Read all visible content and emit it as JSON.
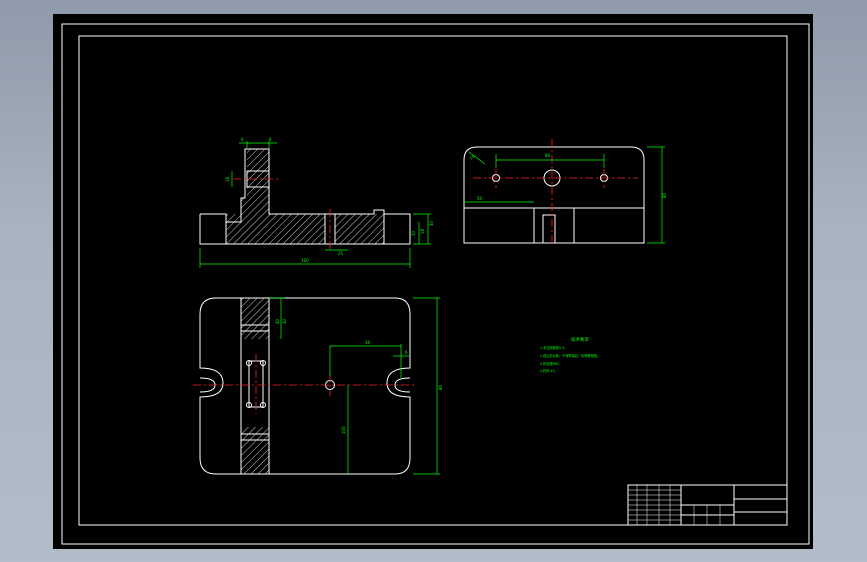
{
  "colors": {
    "background": "#8f9aaa",
    "canvas": "#000000",
    "outline": "#ffffff",
    "dimension": "#00ff00",
    "centerline": "#ff2020"
  },
  "front_view": {
    "dims": [
      "6",
      "6",
      "18",
      "25",
      "160",
      "40",
      "18",
      "10"
    ]
  },
  "side_view": {
    "dims": [
      "15",
      "80",
      "50",
      "80"
    ]
  },
  "top_view": {
    "dims": [
      "6",
      "36",
      "40",
      "40",
      "100",
      "80"
    ]
  },
  "notes": {
    "title": "技术要求",
    "lines": [
      "1.未注明倒角0.5。",
      "2.锐边去毛刺，不得有裂纹、砂眼等缺陷。",
      "3.热处理HRC。",
      "4.材料 45。"
    ]
  },
  "title_block": {
    "cells": [
      "",
      "",
      "",
      ""
    ]
  }
}
